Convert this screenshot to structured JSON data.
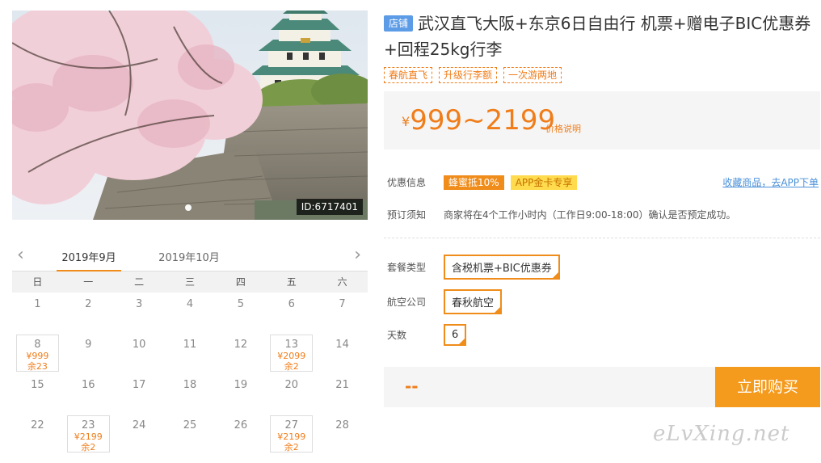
{
  "photo": {
    "id_label": "ID:6717401",
    "dots": 1
  },
  "calendar": {
    "months": [
      "2019年9月",
      "2019年10月"
    ],
    "active_month": 0,
    "weekdays": [
      "日",
      "一",
      "二",
      "三",
      "四",
      "五",
      "六"
    ],
    "days": [
      {
        "d": "1"
      },
      {
        "d": "2"
      },
      {
        "d": "3"
      },
      {
        "d": "4"
      },
      {
        "d": "5"
      },
      {
        "d": "6"
      },
      {
        "d": "7"
      },
      {
        "d": "8",
        "price": "¥999",
        "remain": "余23"
      },
      {
        "d": "9"
      },
      {
        "d": "10"
      },
      {
        "d": "11"
      },
      {
        "d": "12"
      },
      {
        "d": "13",
        "price": "¥2099",
        "remain": "余2"
      },
      {
        "d": "14"
      },
      {
        "d": "15"
      },
      {
        "d": "16"
      },
      {
        "d": "17"
      },
      {
        "d": "18"
      },
      {
        "d": "19"
      },
      {
        "d": "20"
      },
      {
        "d": "21"
      },
      {
        "d": "22"
      },
      {
        "d": "23",
        "price": "¥2199",
        "remain": "余2"
      },
      {
        "d": "24"
      },
      {
        "d": "25"
      },
      {
        "d": "26"
      },
      {
        "d": "27",
        "price": "¥2199",
        "remain": "余2"
      },
      {
        "d": "28"
      }
    ]
  },
  "product": {
    "shop_badge": "店铺",
    "title": "武汉直飞大阪+东京6日自由行 机票+赠电子BIC优惠券+回程25kg行李",
    "tags": [
      "春航直飞",
      "升级行李额",
      "一次游两地"
    ],
    "price_currency": "¥",
    "price_range": "999~2199",
    "price_note": "价格说明",
    "discount_label": "优惠信息",
    "promo_1": "蜂蜜抵10%",
    "promo_2": "APP金卡专享",
    "fav_link": "收藏商品，去APP下单",
    "booking_label": "预订须知",
    "booking_text": "商家将在4个工作小时内（工作日9:00-18:00）确认是否预定成功。",
    "package_label": "套餐类型",
    "package_value": "含税机票+BIC优惠券",
    "airline_label": "航空公司",
    "airline_value": "春秋航空",
    "days_label": "天数",
    "days_value": "6",
    "total": "--",
    "buy_button": "立即购买"
  },
  "watermark": "eLvXing.net",
  "colors": {
    "accent": "#f08c1a",
    "price": "#f07d1a",
    "buy_button": "#f49a1c",
    "shop_badge": "#5c9be6",
    "link": "#4a90d9"
  }
}
